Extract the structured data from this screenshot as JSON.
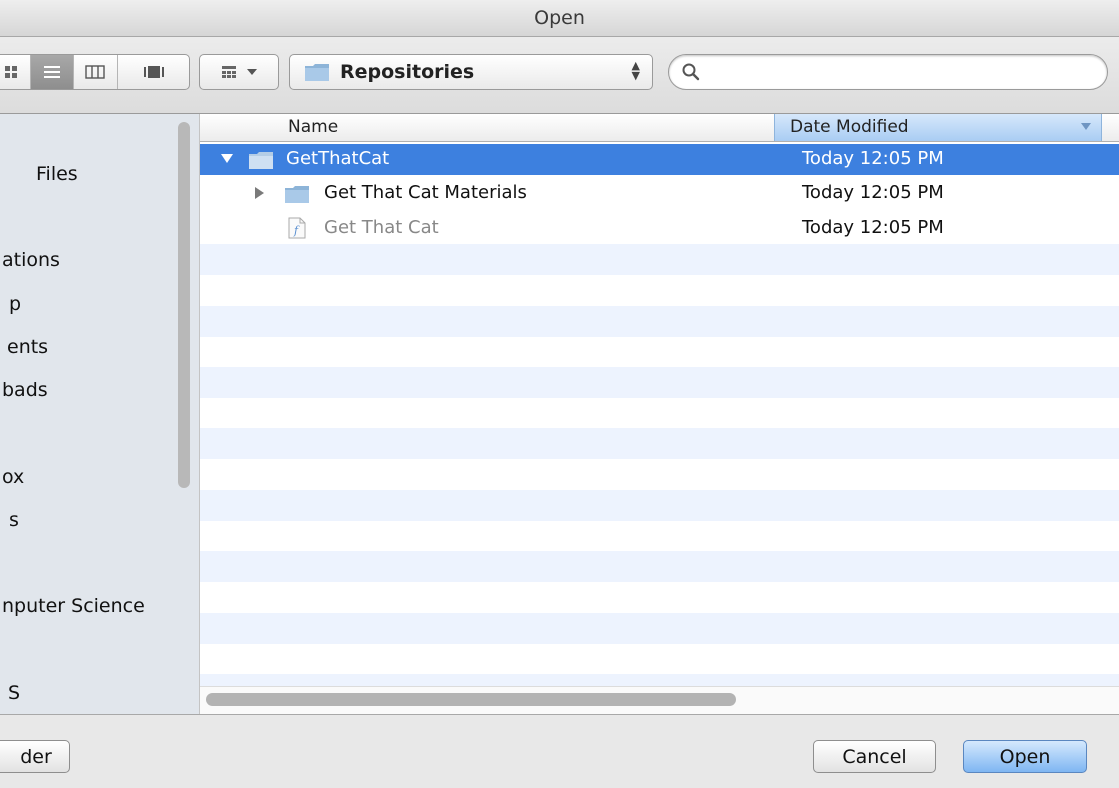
{
  "window": {
    "title": "Open"
  },
  "toolbar": {
    "view_modes": [
      {
        "name": "icon-view",
        "active": false
      },
      {
        "name": "list-view",
        "active": true
      },
      {
        "name": "column-view",
        "active": false
      },
      {
        "name": "coverflow-view",
        "active": false
      }
    ],
    "arrange_icon": "grid-icon",
    "location": {
      "label": "Repositories"
    },
    "search": {
      "placeholder": ""
    }
  },
  "sidebar": {
    "items": [
      {
        "label": "Files"
      },
      {
        "label": "ations"
      },
      {
        "label": "p"
      },
      {
        "label": "ents"
      },
      {
        "label": "bads"
      },
      {
        "label": "ox"
      },
      {
        "label": "s"
      },
      {
        "label": "nputer Science"
      },
      {
        "label": "S"
      }
    ]
  },
  "file_list": {
    "columns": {
      "name": "Name",
      "date": "Date Modified"
    },
    "sort_column": "Date Modified",
    "rows": [
      {
        "name": "GetThatCat",
        "date": "Today 12:05 PM",
        "type": "folder",
        "expanded": true,
        "selected": true,
        "depth": 0
      },
      {
        "name": "Get That Cat Materials",
        "date": "Today 12:05 PM",
        "type": "folder",
        "expanded": false,
        "selected": false,
        "depth": 1
      },
      {
        "name": "Get That Cat",
        "date": "Today 12:05 PM",
        "type": "document",
        "dimmed": true,
        "selected": false,
        "depth": 1
      }
    ]
  },
  "footer": {
    "new_folder_label": "der",
    "cancel_label": "Cancel",
    "open_label": "Open"
  },
  "colors": {
    "selection": "#3d80df",
    "stripe": "#edf3fe",
    "sidebar_bg": "#e1e6ec",
    "default_button": "#7fb6f2"
  }
}
